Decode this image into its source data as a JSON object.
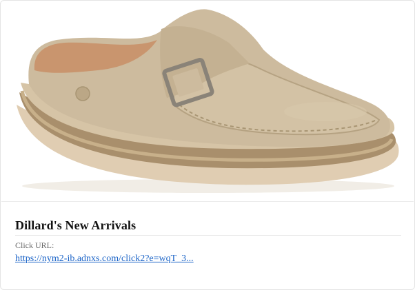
{
  "product_image": {
    "icon": "shoe-image",
    "colors": {
      "suede": "#cdbb9e",
      "suede_shadow": "#b5a282",
      "lining": "#c9956e",
      "midsole": "#a98f6c",
      "sole": "#e0cdb2",
      "buckle": "#8a8378"
    }
  },
  "title": "Dillard's New Arrivals",
  "click_url": {
    "label": "Click URL:",
    "text": "https://nym2-ib.adnxs.com/click2?e=wqT_3..."
  },
  "colors": {
    "link": "#1a63c7",
    "title": "#111111",
    "label": "#6a6a6a"
  }
}
